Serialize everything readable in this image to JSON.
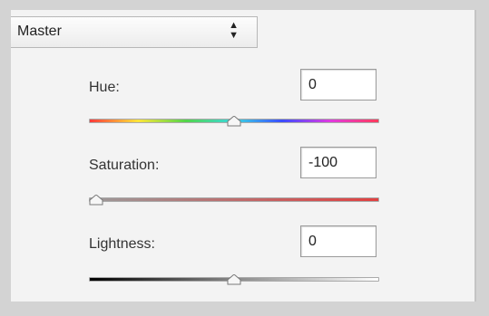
{
  "channel": {
    "selected": "Master"
  },
  "hue": {
    "label": "Hue:",
    "value": "0",
    "slider_position": 0.5
  },
  "saturation": {
    "label": "Saturation:",
    "value": "-100",
    "slider_position": 0.0
  },
  "lightness": {
    "label": "Lightness:",
    "value": "0",
    "slider_position": 0.5
  },
  "icons": {
    "channel_select": "up-down-arrows-icon",
    "slider_thumb": "triangle-thumb-icon"
  }
}
